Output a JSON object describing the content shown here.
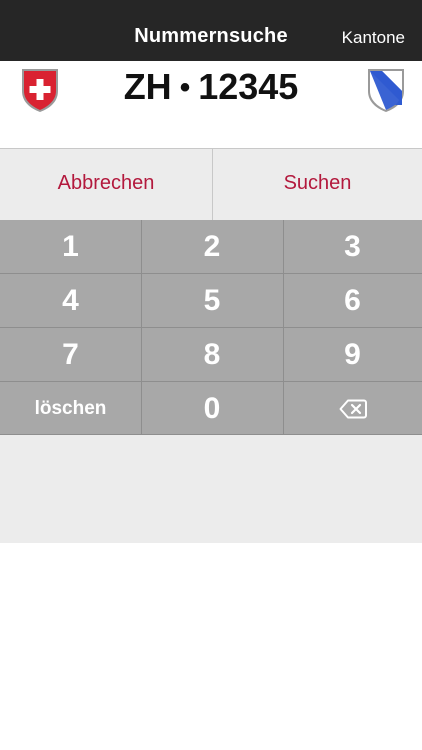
{
  "nav": {
    "title": "Nummernsuche",
    "right_label": "Kantone"
  },
  "plate": {
    "canton": "ZH",
    "separator": "•",
    "number": "12345",
    "left_icon": "swiss-coat-of-arms-icon",
    "right_icon": "zurich-coat-of-arms-icon"
  },
  "actions": {
    "cancel_label": "Abbrechen",
    "search_label": "Suchen"
  },
  "keypad": {
    "keys": [
      "1",
      "2",
      "3",
      "4",
      "5",
      "6",
      "7",
      "8",
      "9",
      "löschen",
      "0"
    ],
    "backspace_icon": "backspace-icon"
  },
  "colors": {
    "navbar": "#262626",
    "accent": "#b3193d",
    "keypad": "#a8a8a8",
    "panel": "#ececec"
  }
}
